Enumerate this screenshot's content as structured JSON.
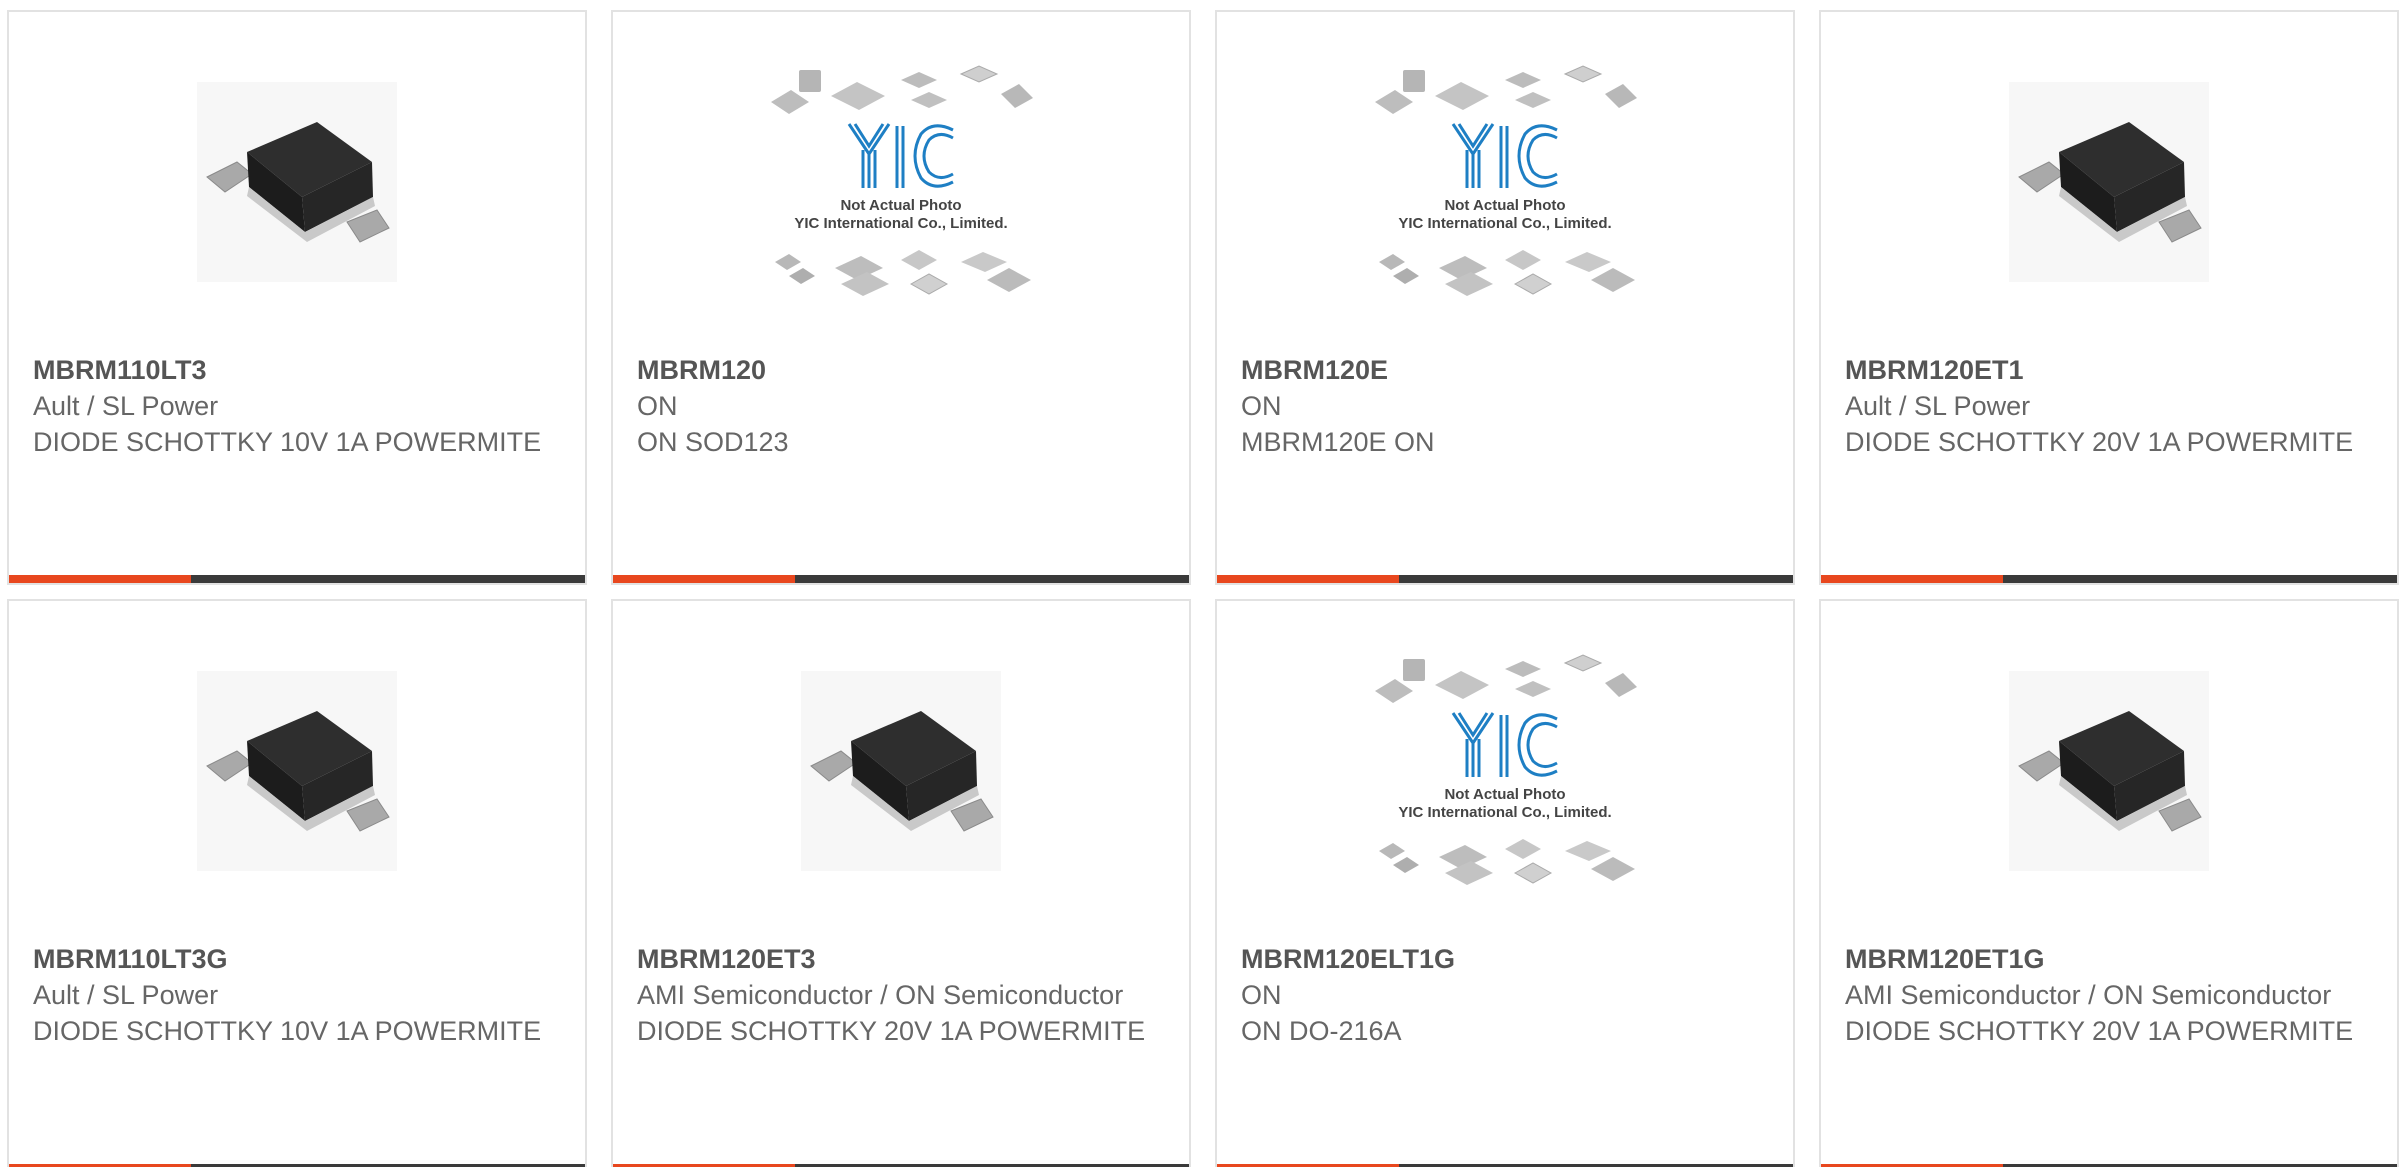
{
  "colors": {
    "accent": "#e8471e",
    "bar": "#3a3a3a",
    "text": "#666666",
    "logo_blue": "#1e7fc4"
  },
  "placeholder_image": {
    "line1": "Not Actual Photo",
    "line2": "YIC International Co., Limited."
  },
  "products": [
    {
      "part": "MBRM110LT3",
      "maker": "Ault / SL Power",
      "desc": "DIODE SCHOTTKY 10V 1A POWERMITE",
      "image": "chip-photo"
    },
    {
      "part": "MBRM120",
      "maker": "ON",
      "desc": "ON SOD123",
      "image": "yic-placeholder"
    },
    {
      "part": "MBRM120E",
      "maker": "ON",
      "desc": "MBRM120E ON",
      "image": "yic-placeholder"
    },
    {
      "part": "MBRM120ET1",
      "maker": "Ault / SL Power",
      "desc": "DIODE SCHOTTKY 20V 1A POWERMITE",
      "image": "chip-photo"
    },
    {
      "part": "MBRM110LT3G",
      "maker": "Ault / SL Power",
      "desc": "DIODE SCHOTTKY 10V 1A POWERMITE",
      "image": "chip-photo"
    },
    {
      "part": "MBRM120ET3",
      "maker": "AMI Semiconductor / ON Semiconductor",
      "desc": "DIODE SCHOTTKY 20V 1A POWERMITE",
      "image": "chip-photo"
    },
    {
      "part": "MBRM120ELT1G",
      "maker": "ON",
      "desc": "ON DO-216A",
      "image": "yic-placeholder"
    },
    {
      "part": "MBRM120ET1G",
      "maker": "AMI Semiconductor / ON Semiconductor",
      "desc": "DIODE SCHOTTKY 20V 1A POWERMITE",
      "image": "chip-photo"
    }
  ]
}
